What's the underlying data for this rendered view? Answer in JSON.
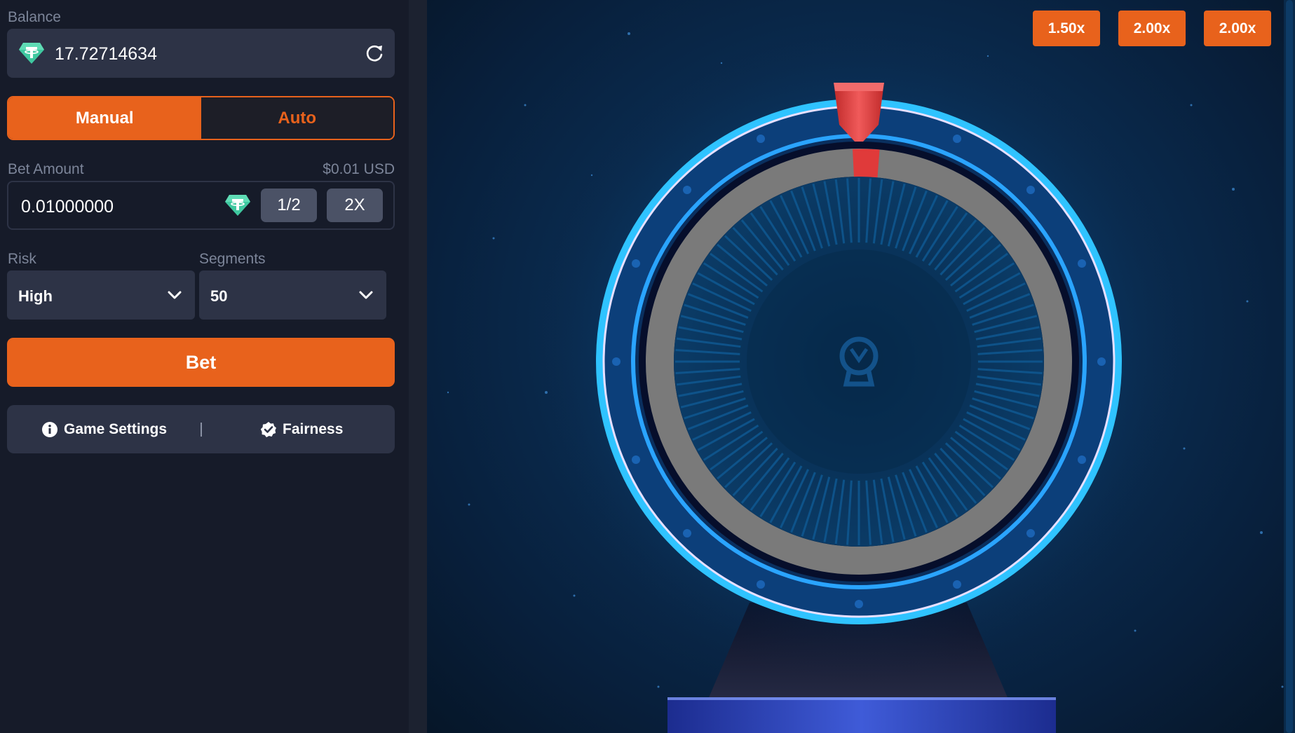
{
  "sidebar": {
    "balance_label": "Balance",
    "balance_value": "17.72714634",
    "mode_tabs": [
      {
        "label": "Manual",
        "active": true
      },
      {
        "label": "Auto",
        "active": false
      }
    ],
    "bet_amount_label": "Bet Amount",
    "bet_amount_usd": "$0.01 USD",
    "bet_amount_value": "0.01000000",
    "half_label": "1/2",
    "double_label": "2X",
    "risk_label": "Risk",
    "risk_value": "High",
    "segments_label": "Segments",
    "segments_value": "50",
    "bet_button_label": "Bet",
    "game_settings_label": "Game Settings",
    "fairness_label": "Fairness",
    "coin_icon": "tether-icon"
  },
  "game": {
    "recent_multipliers": [
      "1.50x",
      "2.00x",
      "2.00x"
    ]
  },
  "colors": {
    "accent": "#e8621c",
    "panel": "#2d3346",
    "background": "#161b29",
    "coin_green": "#3fc8a0",
    "wheel_ring": "#7a7a7a",
    "pointer": "#e03a3a",
    "glow": "#29b8ff"
  }
}
